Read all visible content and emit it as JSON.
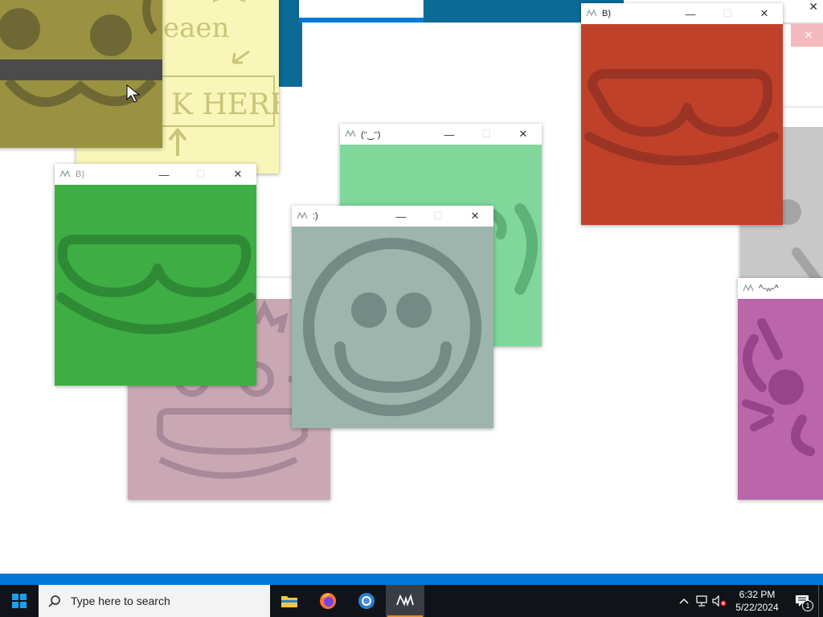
{
  "windows": {
    "notes_window": {
      "lines": [
        "eaen",
        "K HERE"
      ]
    },
    "red_window": {
      "title": "B)",
      "min": "—",
      "close": "✕"
    },
    "green_light_window": {
      "title": "(ᵔ‿ᵔ)",
      "min": "—",
      "close": "✕"
    },
    "green_window": {
      "title": "B)",
      "min": "—",
      "close": "✕"
    },
    "grey_window": {
      "title": ":)",
      "min": "—",
      "close": "✕"
    },
    "purple_window": {
      "title": "^-ᵥᵥ-^"
    },
    "top_right_close": {
      "label": "✕"
    }
  },
  "taskbar": {
    "search_placeholder": "Type here to search",
    "apps": [
      "file-explorer",
      "firefox",
      "chrome",
      "sticky-app"
    ],
    "time": "6:32 PM",
    "date": "5/22/2024",
    "notification_count": "1"
  },
  "colors": {
    "olive": "#9a9241",
    "yellow_note": "#f8f6b8",
    "red": "#c0412a",
    "light_green": "#7fd89a",
    "green": "#3eae44",
    "grey_teal": "#9db5ad",
    "pink": "#c9a8b4",
    "magenta": "#bb66aa",
    "light_grey": "#c8c8c8",
    "teal_blue": "#0b6b94",
    "accent_blue": "#0078d7"
  }
}
